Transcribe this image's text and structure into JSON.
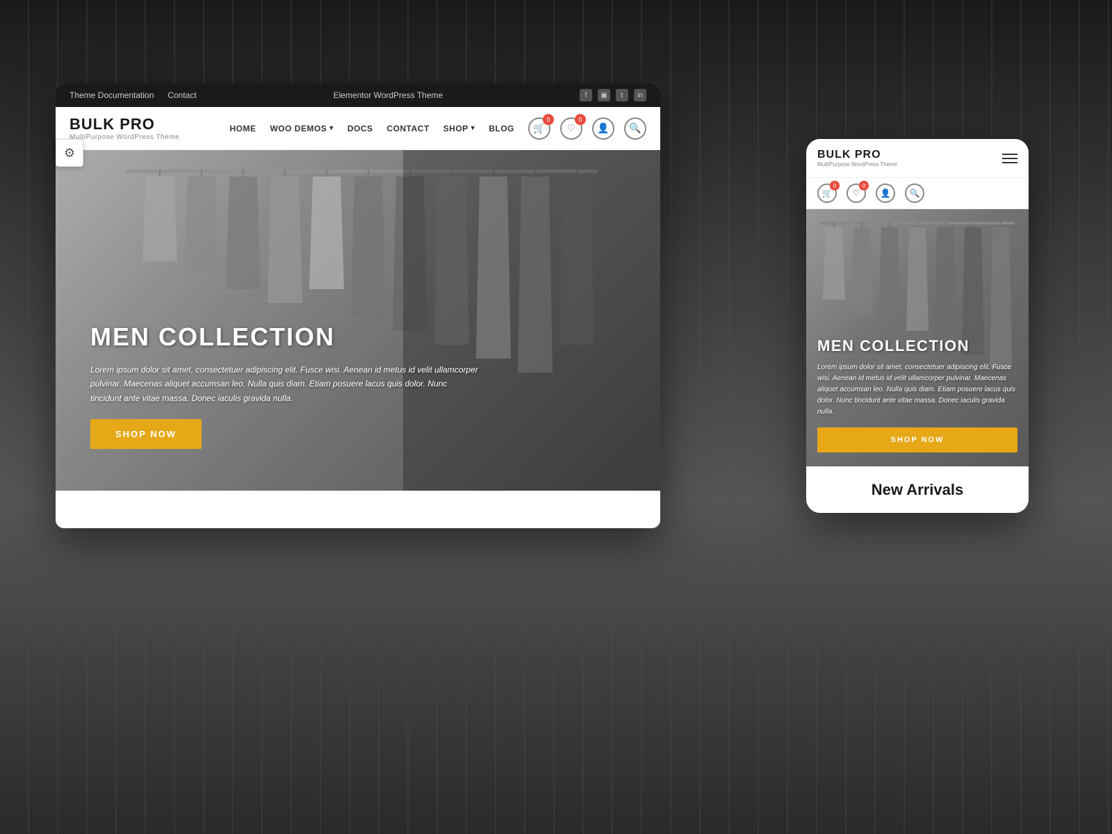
{
  "page": {
    "background_color": "#3a3a3a"
  },
  "top_bar": {
    "left_links": [
      "Theme Documentation",
      "Contact"
    ],
    "center_text": "Elementor WordPress Theme",
    "social_icons": [
      "f",
      "ig",
      "tw",
      "in"
    ]
  },
  "desktop": {
    "logo": {
      "title": "BULK PRO",
      "subtitle": "MultiPurpose WordPress Theme"
    },
    "nav": {
      "links": [
        "HOME",
        "WOO DEMOS",
        "DOCS",
        "CONTACT",
        "SHOP",
        "BLOG"
      ],
      "dropdown_links": [
        "WOO DEMOS",
        "SHOP"
      ],
      "cart_count": "0",
      "wishlist_count": "0"
    },
    "hero": {
      "title": "MEN COLLECTION",
      "description": "Lorem ipsum dolor sit amet, consectetuer adipiscing elit. Fusce wisi. Aenean id metus id velit ullamcorper pulvinar. Maecenas aliquet accumsan leo. Nulla quis diam. Etiam posuere lacus quis dolor. Nunc tincidunt ante vitae massa. Donec iaculis gravida nulla.",
      "button_label": "SHOP NOW"
    }
  },
  "mobile": {
    "logo": {
      "title": "BULK PRO",
      "subtitle": "MultiPurpose WordPress Theme"
    },
    "cart_count": "0",
    "wishlist_count": "0",
    "hero": {
      "title": "MEN COLLECTION",
      "description": "Lorem ipsum dolor sit amet, consectetuer adipiscing elit. Fusce wisi. Aenean id metus id velit ullamcorper pulvinar. Maecenas aliquet accumsan leo. Nulla quis diam. Etiam posuere lacus quis dolor. Nunc tincidunt ante vitae massa. Donec iaculis gravida nulla.",
      "button_label": "SHOP NOW"
    },
    "new_arrivals": {
      "title": "New Arrivals"
    }
  },
  "colors": {
    "accent": "#e6a817",
    "dark": "#1a1a1a",
    "nav_bg": "#ffffff",
    "topbar_bg": "#1a1a1a"
  }
}
